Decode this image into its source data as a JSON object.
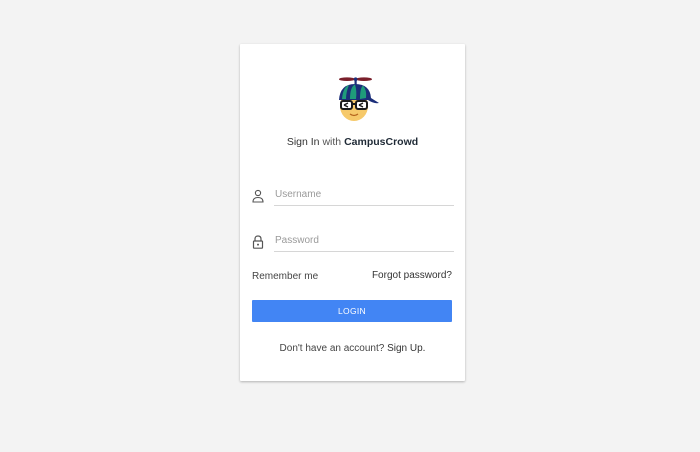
{
  "title": {
    "prefix": "Sign In",
    "with": "with",
    "brand": "CampusCrowd"
  },
  "logo": {
    "icon": "propeller-cap-nerd-icon",
    "colors": {
      "cap_green": "#1f9c7a",
      "cap_navy": "#1c2f7a",
      "face": "#f6c96a",
      "glasses": "#1b1b1b"
    }
  },
  "form": {
    "username": {
      "icon": "person-icon",
      "placeholder": "Username",
      "value": ""
    },
    "password": {
      "icon": "lock-icon",
      "placeholder": "Password",
      "value": ""
    },
    "remember_label": "Remember me",
    "forgot_label": "Forgot password?",
    "login_label": "LOGIN"
  },
  "footer": {
    "prompt": "Don't have an account?",
    "signup_label": "Sign Up."
  },
  "colors": {
    "accent": "#4285f4",
    "background": "#f3f3f3"
  }
}
